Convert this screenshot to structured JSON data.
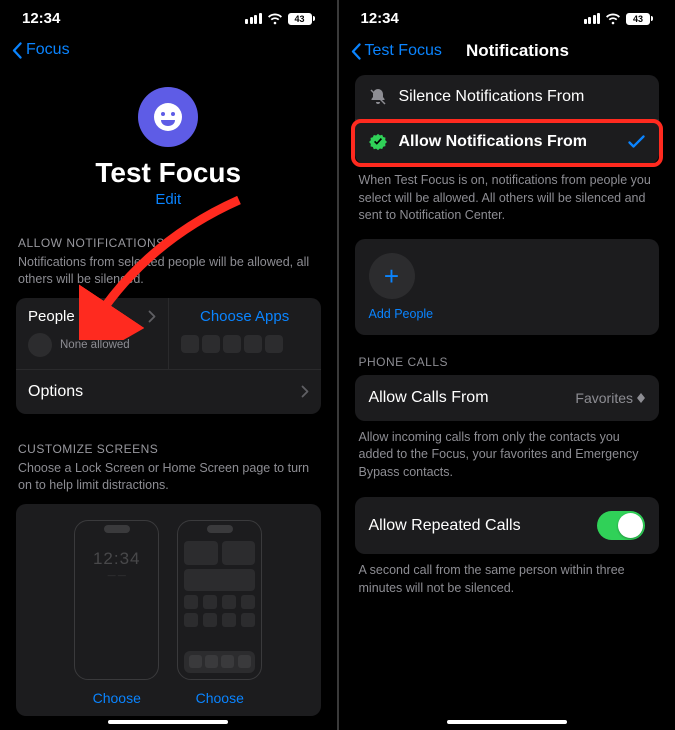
{
  "status": {
    "time": "12:34",
    "battery": "43"
  },
  "left": {
    "back": "Focus",
    "focus_name": "Test Focus",
    "edit": "Edit",
    "allow_header": "ALLOW NOTIFICATIONS",
    "allow_desc": "Notifications from selected people will be allowed, all others will be silenced.",
    "people_label": "People",
    "people_sub": "None allowed",
    "apps_label": "Choose Apps",
    "options_label": "Options",
    "customize_header": "CUSTOMIZE SCREENS",
    "customize_desc": "Choose a Lock Screen or Home Screen page to turn on to help limit distractions.",
    "lock_time": "12:34",
    "choose": "Choose"
  },
  "right": {
    "back": "Test Focus",
    "title": "Notifications",
    "silence_label": "Silence Notifications From",
    "allow_label": "Allow Notifications From",
    "explain": "When Test Focus is on, notifications from people you select will be allowed. All others will be silenced and sent to Notification Center.",
    "add_people": "Add People",
    "phone_calls_header": "PHONE CALLS",
    "allow_calls_label": "Allow Calls From",
    "allow_calls_value": "Favorites",
    "allow_calls_desc": "Allow incoming calls from only the contacts you added to the Focus, your favorites and Emergency Bypass contacts.",
    "repeated_label": "Allow Repeated Calls",
    "repeated_desc": "A second call from the same person within three minutes will not be silenced."
  }
}
